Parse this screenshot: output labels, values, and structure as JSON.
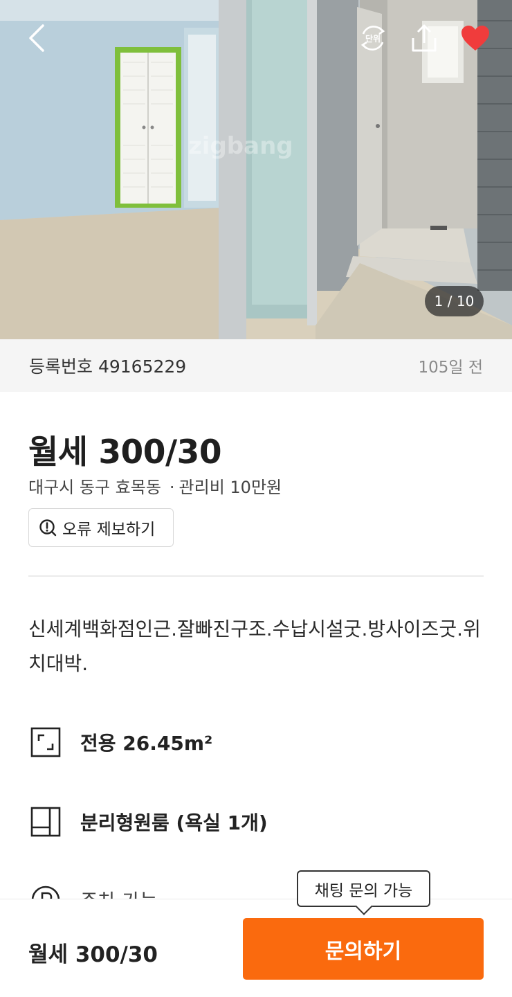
{
  "photo": {
    "watermark": "zigbang",
    "counter": "1 / 10",
    "unit_label": "단위"
  },
  "listing": {
    "registration_label": "등록번호 49165229",
    "posted_ago": "105일 전",
    "price": "월세 300/30",
    "address": "대구시 동구 효목동",
    "maintenance_fee": "관리비 10만원",
    "report_label": "오류 제보하기",
    "description": "신세계백화점인근.잘빠진구조.수납시설굿.방사이즈굿.위치대박."
  },
  "features": {
    "area": "전용 26.45m²",
    "room_type": "분리형원룸 (욕실 1개)",
    "parking": "주차 가능"
  },
  "bottom": {
    "price": "월세 300/30",
    "inquire_label": "문의하기",
    "tooltip": "채팅 문의 가능"
  },
  "colors": {
    "accent": "#fa6a0e",
    "heart": "#f03c3c"
  },
  "icons": {
    "back": "chevron-left-icon",
    "unit": "unit-toggle-icon",
    "share": "share-icon",
    "favorite": "heart-icon",
    "report": "alert-circle-icon",
    "area": "area-frame-icon",
    "room": "floorplan-icon",
    "parking": "parking-icon"
  }
}
